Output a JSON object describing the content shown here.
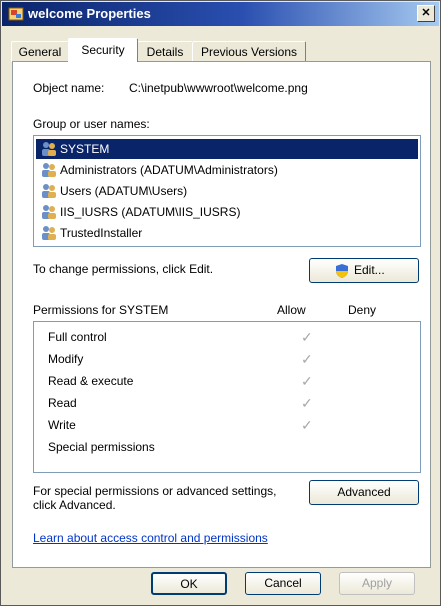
{
  "window": {
    "title": "welcome Properties",
    "close_label": "✕"
  },
  "tabs": [
    {
      "label": "General",
      "active": false
    },
    {
      "label": "Security",
      "active": true
    },
    {
      "label": "Details",
      "active": false
    },
    {
      "label": "Previous Versions",
      "active": false
    }
  ],
  "security": {
    "object_name_label": "Object name:",
    "object_name_value": "C:\\inetpub\\wwwroot\\welcome.png",
    "group_label": "Group or user names:",
    "users": [
      {
        "name": "SYSTEM",
        "selected": true
      },
      {
        "name": "Administrators (ADATUM\\Administrators)",
        "selected": false
      },
      {
        "name": "Users (ADATUM\\Users)",
        "selected": false
      },
      {
        "name": "IIS_IUSRS (ADATUM\\IIS_IUSRS)",
        "selected": false
      },
      {
        "name": "TrustedInstaller",
        "selected": false
      }
    ],
    "change_text": "To change permissions, click Edit.",
    "edit_button": "Edit...",
    "perm_header": "Permissions for SYSTEM",
    "allow_header": "Allow",
    "deny_header": "Deny",
    "permissions": [
      {
        "name": "Full control",
        "allow": true,
        "deny": false
      },
      {
        "name": "Modify",
        "allow": true,
        "deny": false
      },
      {
        "name": "Read & execute",
        "allow": true,
        "deny": false
      },
      {
        "name": "Read",
        "allow": true,
        "deny": false
      },
      {
        "name": "Write",
        "allow": true,
        "deny": false
      },
      {
        "name": "Special permissions",
        "allow": false,
        "deny": false
      }
    ],
    "advanced_text_line1": "For special permissions or advanced settings,",
    "advanced_text_line2": "click Advanced.",
    "advanced_button": "Advanced",
    "learn_link": "Learn about access control and permissions"
  },
  "footer": {
    "ok": "OK",
    "cancel": "Cancel",
    "apply": "Apply"
  }
}
